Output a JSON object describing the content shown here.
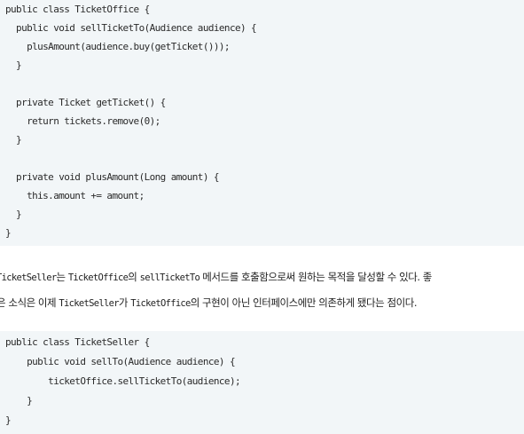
{
  "code_block_1": {
    "lines": [
      "public class TicketOffice {",
      "  public void sellTicketTo(Audience audience) {",
      "    plusAmount(audience.buy(getTicket()));",
      "  }",
      "",
      "  private Ticket getTicket() {",
      "    return tickets.remove(0);",
      "  }",
      "",
      "  private void plusAmount(Long amount) {",
      "    this.amount += amount;",
      "  }",
      "}"
    ]
  },
  "paragraph": {
    "line1": {
      "c1": "TicketSeller",
      "t1": "는 ",
      "c2": "TicketOffice",
      "t2": "의 ",
      "c3": "sellTicketTo",
      "t3": " 메서드를 호출함으로써 원하는 목적을 달성할 수 있다. 좋"
    },
    "line2": {
      "t1": "은 소식은 이제 ",
      "c1": "TicketSeller",
      "t2": "가 ",
      "c2": "TicketOffice",
      "t3": "의 구현이 아닌 인터페이스에만 의존하게 됐다는 점이다."
    }
  },
  "code_block_2": {
    "lines": [
      "public class TicketSeller {",
      "    public void sellTo(Audience audience) {",
      "        ticketOffice.sellTicketTo(audience);",
      "    }",
      "}"
    ]
  }
}
